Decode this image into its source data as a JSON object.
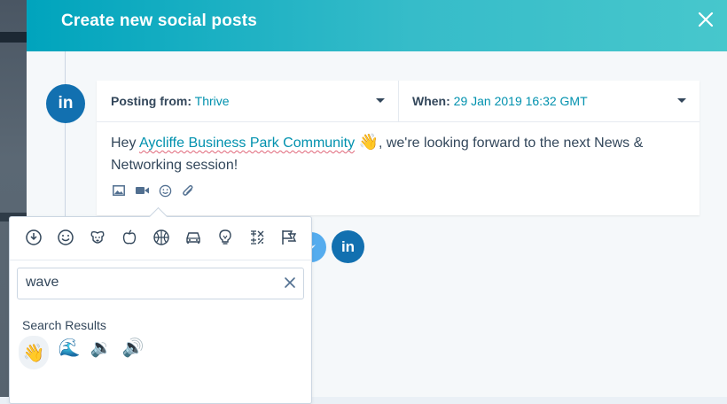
{
  "modal": {
    "title": "Create new social posts"
  },
  "post": {
    "network_icon": "linkedin-icon",
    "network_label": "in",
    "posting_from_label": "Posting from:",
    "posting_from_value": "Thrive",
    "when_label": "When:",
    "when_value": "29 Jan 2019 16:32 GMT",
    "text_prefix": "Hey ",
    "mention": "Aycliffe Business Park Community",
    "emoji": "👋",
    "text_suffix": ", we're looking forward to the next News & Networking session!",
    "tools": [
      "image-icon",
      "video-icon",
      "emoji-icon",
      "attachment-icon"
    ]
  },
  "channels": {
    "linkedin_label": "in"
  },
  "emoji_picker": {
    "categories": [
      "recent-icon",
      "smileys-icon",
      "animals-icon",
      "food-icon",
      "activity-icon",
      "travel-icon",
      "objects-icon",
      "symbols-icon",
      "flags-icon"
    ],
    "search_value": "wave",
    "results_label": "Search Results",
    "results": [
      "👋",
      "🌊",
      "🔉",
      "🔊"
    ]
  },
  "colors": {
    "header_start": "#00a4bd",
    "header_end": "#47c7cc",
    "link": "#0091ae",
    "text": "#33475b",
    "linkedin": "#1270b0",
    "twitter": "#55acee"
  }
}
